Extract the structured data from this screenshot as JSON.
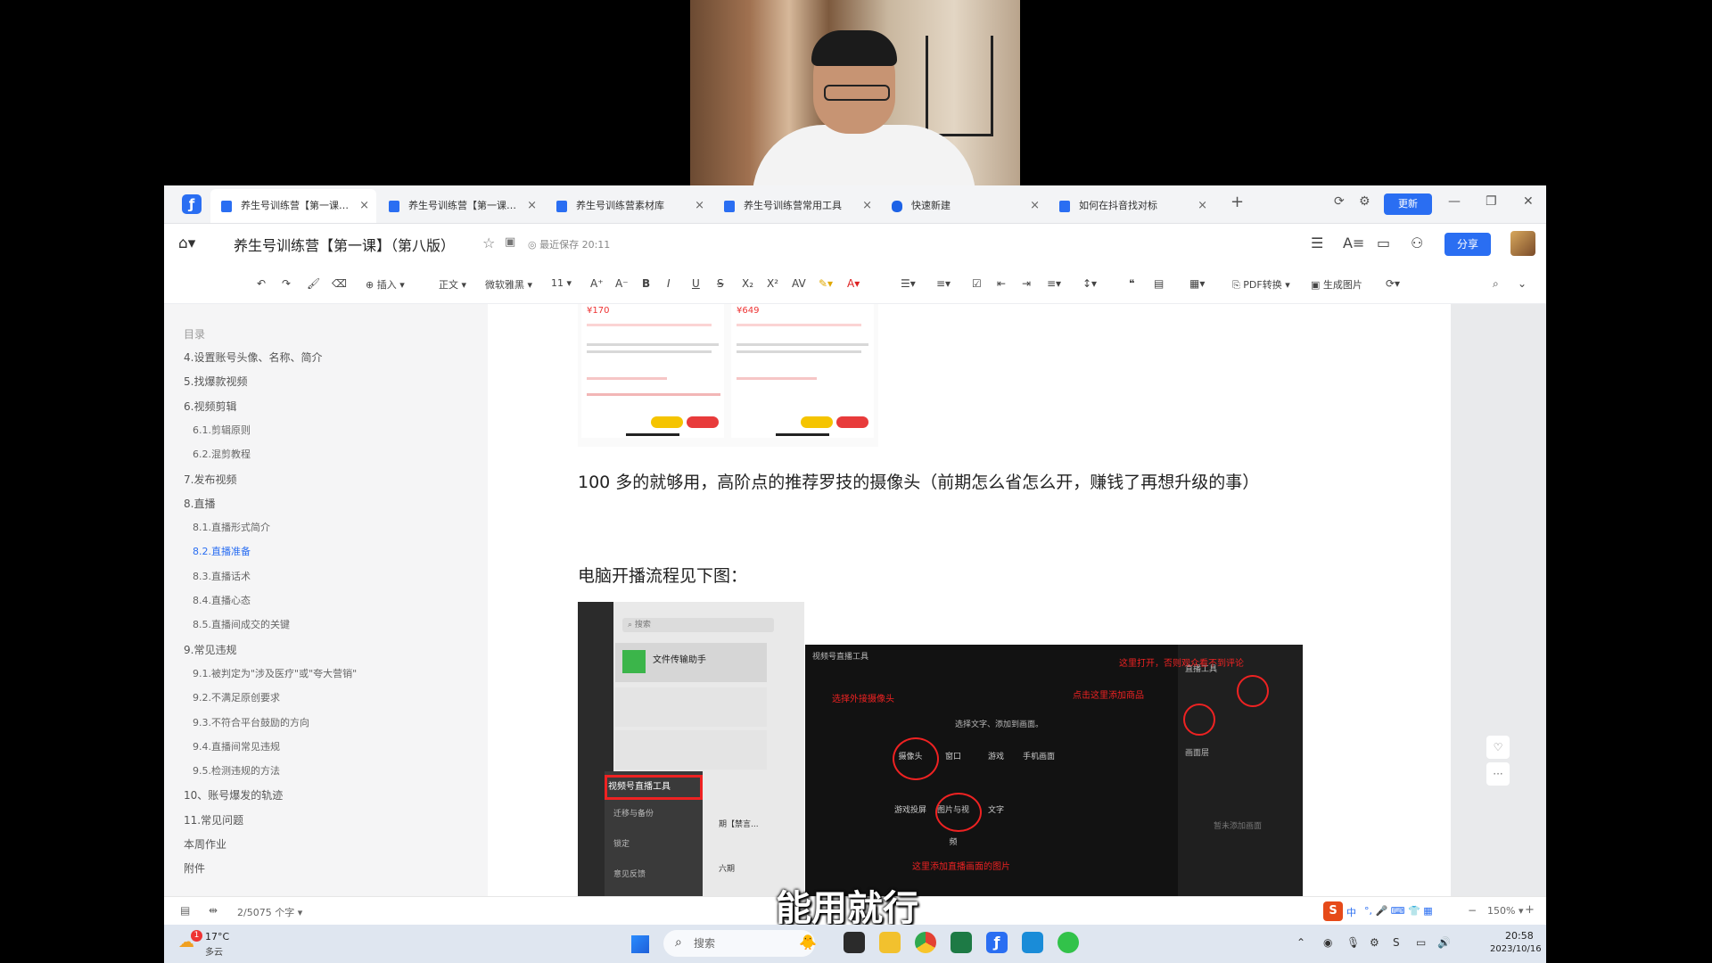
{
  "tabs": [
    {
      "label": "养生号训练营【第一课】..."
    },
    {
      "label": "养生号训练营【第一课】..."
    },
    {
      "label": "养生号训练营素材库"
    },
    {
      "label": "养生号训练营常用工具"
    },
    {
      "label": "快速新建"
    },
    {
      "label": "如何在抖音找对标"
    }
  ],
  "tabbar": {
    "update_label": "更新"
  },
  "titlebar": {
    "doc_title": "养生号训练营【第一课】（第八版）",
    "save_status": "最近保存 20:11",
    "share_label": "分享"
  },
  "toolbar": {
    "insert_label": "插入",
    "style_label": "正文",
    "font_label": "微软雅黑",
    "size_label": "11",
    "pdf_label": "PDF转换",
    "image_label": "生成图片"
  },
  "toc": {
    "title": "目录",
    "items": [
      {
        "label": "4.设置账号头像、名称、简介",
        "level": 1
      },
      {
        "label": "5.找爆款视频",
        "level": 1
      },
      {
        "label": "6.视频剪辑",
        "level": 1
      },
      {
        "label": "6.1.剪辑原则",
        "level": 2
      },
      {
        "label": "6.2.混剪教程",
        "level": 2
      },
      {
        "label": "7.发布视频",
        "level": 1
      },
      {
        "label": "8.直播",
        "level": 1
      },
      {
        "label": "8.1.直播形式简介",
        "level": 2
      },
      {
        "label": "8.2.直播准备",
        "level": 2,
        "current": true
      },
      {
        "label": "8.3.直播话术",
        "level": 2
      },
      {
        "label": "8.4.直播心态",
        "level": 2
      },
      {
        "label": "8.5.直播间成交的关键",
        "level": 2
      },
      {
        "label": "9.常见违规",
        "level": 1
      },
      {
        "label": "9.1.被判定为\"涉及医疗\"或\"夸大营销\"",
        "level": 2
      },
      {
        "label": "9.2.不满足原创要求",
        "level": 2
      },
      {
        "label": "9.3.不符合平台鼓励的方向",
        "level": 2
      },
      {
        "label": "9.4.直播间常见违规",
        "level": 2
      },
      {
        "label": "9.5.检测违规的方法",
        "level": 2
      },
      {
        "label": "10、账号爆发的轨迹",
        "level": 1
      },
      {
        "label": "11.常见问题",
        "level": 1
      },
      {
        "label": "本周作业",
        "level": 1
      },
      {
        "label": "附件",
        "level": 1
      }
    ]
  },
  "doc": {
    "para1": "100 多的就够用，高阶点的推荐罗技的摄像头（前期怎么省怎么开，赚钱了再想升级的事）",
    "para2": "电脑开播流程见下图：",
    "products": [
      {
        "price": "¥170"
      },
      {
        "price": "¥649"
      }
    ],
    "chat_shot": {
      "search": "搜索",
      "first_chat": "文件传输助手",
      "menu_highlight": "视频号直播工具",
      "menu_items": [
        "迁移与备份",
        "锁定",
        "意见反馈"
      ],
      "chat_snippet": "期【禁言...",
      "chat_snippet2": "六期"
    },
    "stream_shot": {
      "window_title": "视频号直播工具",
      "add_scene_hint": "选择文字、添加到画面。",
      "buttons": [
        "摄像头",
        "窗口",
        "游戏",
        "手机画面",
        "游戏投屏",
        "图片与视频",
        "文字"
      ],
      "annotations": {
        "camera": "选择外接摄像头",
        "product": "点击这里添加商品",
        "open": "这里打开，否则观众看不到评论",
        "image": "这里添加直播画面的图片"
      },
      "panel_title": "直播工具",
      "panel_section": "画面层",
      "panel_empty": "暂未添加画面"
    }
  },
  "statusbar": {
    "word_count": "2/5075 个字",
    "zoom": "150%"
  },
  "subtitle": "能用就行",
  "taskbar": {
    "weather_temp": "17°C",
    "weather_desc": "多云",
    "weather_badge": "1",
    "search_label": "搜索",
    "ime_label": "中",
    "clock_time": "20:58",
    "clock_date": "2023/10/16"
  },
  "colors": {
    "accent": "#2a6ef2",
    "annotation_red": "#e22222"
  }
}
